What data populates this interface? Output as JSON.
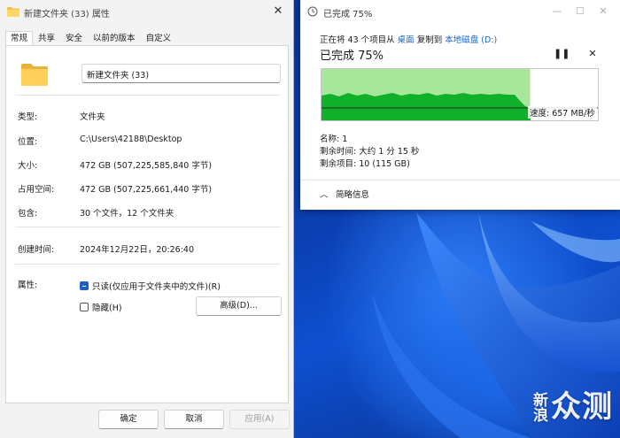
{
  "properties": {
    "title": "新建文件夹 (33) 属性",
    "tabs": [
      "常规",
      "共享",
      "安全",
      "以前的版本",
      "自定义"
    ],
    "name_value": "新建文件夹 (33)",
    "fields": [
      {
        "key": "类型:",
        "value": "文件夹"
      },
      {
        "key": "位置:",
        "value": "C:\\Users\\42188\\Desktop"
      },
      {
        "key": "大小:",
        "value": "472 GB (507,225,585,840 字节)"
      },
      {
        "key": "占用空间:",
        "value": "472 GB (507,225,661,440 字节)"
      },
      {
        "key": "包含:",
        "value": "30 个文件，12 个文件夹"
      }
    ],
    "created_label": "创建时间:",
    "created_value": "2024年12月22日，20:26:40",
    "attributes_label": "属性:",
    "readonly_label": "只读(仅应用于文件夹中的文件)(R)",
    "readonly_checked": true,
    "hidden_label": "隐藏(H)",
    "hidden_checked": false,
    "advanced_button": "高级(D)...",
    "ok_button": "确定",
    "cancel_button": "取消",
    "apply_button": "应用(A)"
  },
  "copy_dialog": {
    "title": "已完成 75%",
    "status_prefix": "正在将 43 个项目从",
    "source": "桌面",
    "copy_to": "复制到",
    "destination": "本地磁盘 (D:)",
    "percent_label": "已完成 75%",
    "progress_fraction": 0.75,
    "speed_label": "速度: 657 MB/秒",
    "name_line": "名称: 1",
    "time_left": "剩余时间: 大约 1 分 15 秒",
    "items_left": "剩余项目: 10 (115 GB)",
    "details_label": "简略信息",
    "colors": {
      "graph_done": "#a8e69b",
      "graph_speed": "#10b02a",
      "link": "#1e63c4"
    }
  },
  "watermark": {
    "big1": "新浪",
    "big2": "众测"
  }
}
